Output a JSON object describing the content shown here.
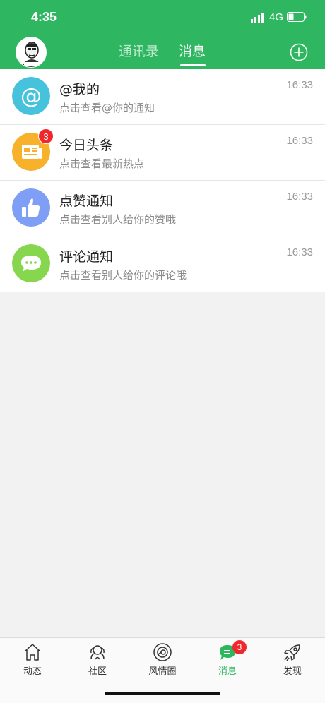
{
  "status_bar": {
    "time": "4:35",
    "network": "4G"
  },
  "header": {
    "tabs": [
      {
        "label": "通讯录",
        "active": false
      },
      {
        "label": "消息",
        "active": true
      }
    ],
    "avatar_icon": "user-avatar-icon",
    "add_icon": "plus-circle-icon"
  },
  "messages": [
    {
      "title": "@我的",
      "subtitle": "点击查看@你的通知",
      "time": "16:33",
      "icon": "at-sign-icon",
      "color": "#46c2dd",
      "badge": ""
    },
    {
      "title": "今日头条",
      "subtitle": "点击查看最新热点",
      "time": "16:33",
      "icon": "newspaper-icon",
      "color": "#f7b12a",
      "badge": "3"
    },
    {
      "title": "点赞通知",
      "subtitle": "点击查看别人给你的赞哦",
      "time": "16:33",
      "icon": "thumbs-up-icon",
      "color": "#7f9ef5",
      "badge": ""
    },
    {
      "title": "评论通知",
      "subtitle": "点击查看别人给你的评论哦",
      "time": "16:33",
      "icon": "comment-bubble-icon",
      "color": "#86d64e",
      "badge": ""
    }
  ],
  "bottom_nav": [
    {
      "label": "动态",
      "icon": "home-icon",
      "active": false
    },
    {
      "label": "社区",
      "icon": "community-icon",
      "active": false
    },
    {
      "label": "风情圈",
      "icon": "circle-camera-icon",
      "active": false
    },
    {
      "label": "消息",
      "icon": "message-bubble-icon",
      "active": true,
      "badge": "3"
    },
    {
      "label": "发现",
      "icon": "rocket-icon",
      "active": false
    }
  ],
  "colors": {
    "brand": "#2eb760",
    "badge": "#f0282d"
  }
}
